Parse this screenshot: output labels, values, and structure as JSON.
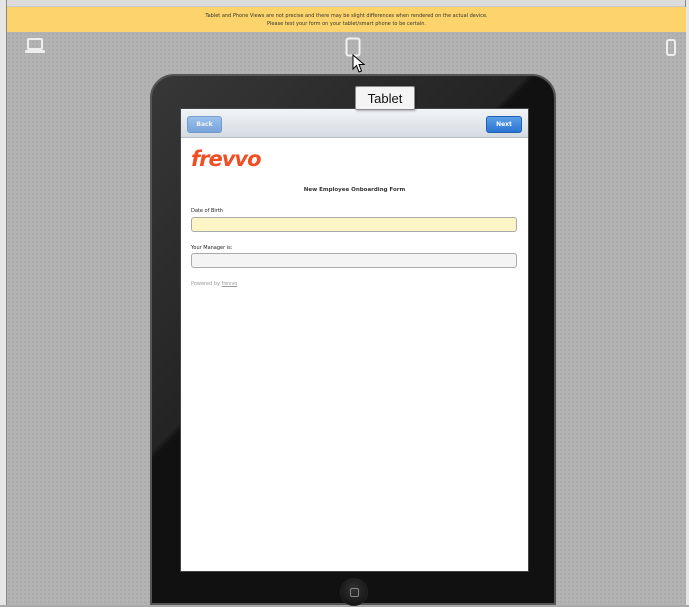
{
  "banner": {
    "line1": "Tablet and Phone Views are not precise and there may be slight differences when rendered on the actual device.",
    "line2": "Please test your form on your tablet/smart phone to be certain."
  },
  "view_switcher": {
    "icons": [
      "laptop-icon",
      "tablet-icon",
      "phone-icon"
    ],
    "selected": "tablet",
    "tooltip": "Tablet"
  },
  "form": {
    "back_label": "Back",
    "next_label": "Next",
    "logo_text": "frevvo",
    "title": "New Employee Onboarding Form",
    "fields": [
      {
        "label": "Date of Birth",
        "value": ""
      },
      {
        "label": "Your Manager is:",
        "value": ""
      }
    ],
    "powered_by_prefix": "Powered by",
    "powered_by_link": "frevvo"
  },
  "colors": {
    "banner": "#fcd46b",
    "accent": "#2a74d2",
    "logo": "#f04e23",
    "highlighted_field": "#fdf5c6"
  }
}
